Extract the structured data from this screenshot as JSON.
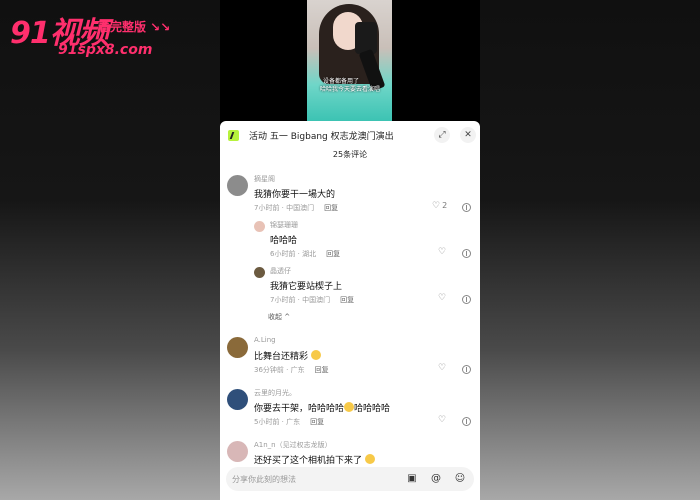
{
  "watermark": {
    "brand": "91视频",
    "slogan": "看完整版 ↘↘",
    "url": "91spx8.com",
    "color": "#ff2f6d"
  },
  "video": {
    "subtitle_line1": "设备都备用了",
    "subtitle_line2": "哈哈我今天要去看演唱"
  },
  "sheet": {
    "title": "活动  五一 Bigbang 权志龙澳门演出",
    "count_label": "25条评论",
    "expand_icon": "expand-icon",
    "close_icon": "close-icon"
  },
  "comments": [
    {
      "username": "摘星阁",
      "text": "我猜你要干一場大的",
      "time": "7小时前 · 中国澳门",
      "reply": "回复",
      "likes": "2",
      "avatar_color": "#8c8c8c"
    },
    {
      "username": "锦瑟珊珊",
      "text": "哈哈哈",
      "time": "6小时前 · 湖北",
      "reply": "回复",
      "likes": "",
      "avatar_color": "#e8c2b6"
    },
    {
      "username": "晶透仔",
      "text": "我猜它要站楔子上",
      "time": "7小时前 · 中国澳门",
      "reply": "回复",
      "likes": "",
      "avatar_color": "#6b5a40"
    },
    {
      "username": "A.Ling",
      "text": "比舞台还精彩",
      "time": "36分钟前 · 广东",
      "reply": "回复",
      "likes": "",
      "avatar_color": "#8a6a3a"
    },
    {
      "username": "云里的月光。",
      "text_a": "你要去干架，哈哈哈哈",
      "text_b": "哈哈哈哈",
      "time": "5小时前 · 广东",
      "reply": "回复",
      "likes": "",
      "avatar_color": "#2f4f7a"
    },
    {
      "username": "A1n_n（见过权志龙版）",
      "text": "还好买了这个相机拍下来了",
      "avatar_color": "#d8b7b7"
    }
  ],
  "collapse_label": "收起 ^",
  "input": {
    "placeholder": "分享你此刻的想法"
  }
}
